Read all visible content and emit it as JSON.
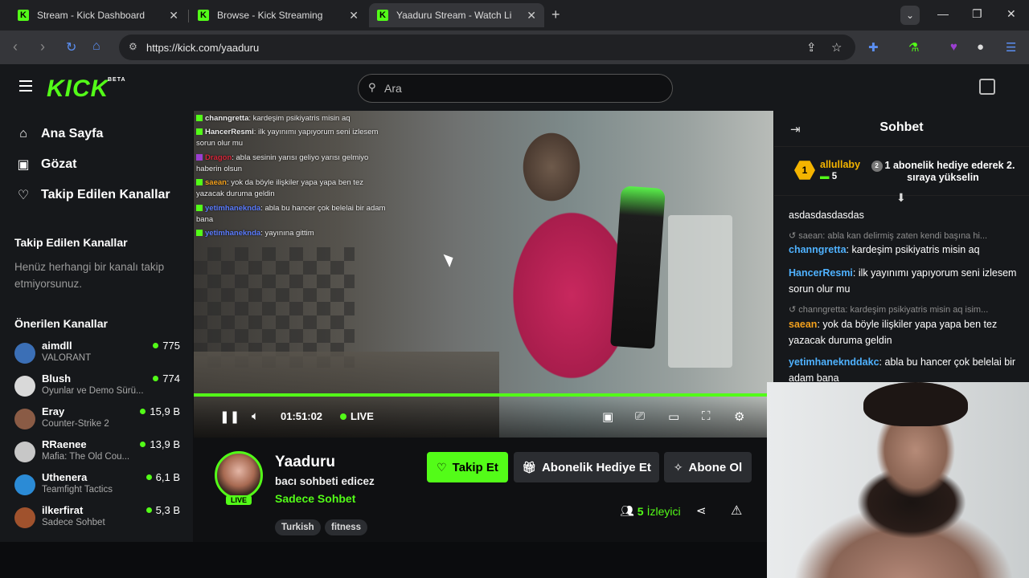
{
  "browser": {
    "tabs": [
      {
        "title": "Stream - Kick Dashboard",
        "active": false
      },
      {
        "title": "Browse - Kick Streaming",
        "active": false
      },
      {
        "title": "Yaaduru Stream - Watch Li",
        "active": true
      }
    ],
    "url": "https://kick.com/yaaduru"
  },
  "header": {
    "logo": "KICK",
    "logo_badge": "BETA",
    "search_placeholder": "Ara"
  },
  "sidebar": {
    "nav": [
      {
        "label": "Ana Sayfa",
        "icon": "home-icon"
      },
      {
        "label": "Gözat",
        "icon": "browse-icon"
      },
      {
        "label": "Takip Edilen Kanallar",
        "icon": "heart-icon"
      }
    ],
    "followed_title": "Takip Edilen Kanallar",
    "followed_empty": "Henüz herhangi bir kanalı takip etmiyorsunuz.",
    "recommended_title": "Önerilen Kanallar",
    "channels": [
      {
        "name": "aimdll",
        "category": "VALORANT",
        "viewers": "775",
        "color": "#3b6fb6"
      },
      {
        "name": "Blush",
        "category": "Oyunlar ve Demo Sürü...",
        "viewers": "774",
        "color": "#d9d9d9"
      },
      {
        "name": "Eray",
        "category": "Counter-Strike 2",
        "viewers": "15,9 B",
        "color": "#8a5b45"
      },
      {
        "name": "RRaenee",
        "category": "Mafia: The Old Cou...",
        "viewers": "13,9 B",
        "color": "#c7c7c7"
      },
      {
        "name": "Uthenera",
        "category": "Teamfight Tactics",
        "viewers": "6,1 B",
        "color": "#2b8bd6"
      },
      {
        "name": "ilkerfirat",
        "category": "Sadece Sohbet",
        "viewers": "5,3 B",
        "color": "#a0522d"
      }
    ]
  },
  "video": {
    "overlay_chat": [
      {
        "user": "channgretta",
        "color": "#ffffff",
        "text": ": kardeşim psikiyatris misin aq"
      },
      {
        "user": "HancerResmi",
        "color": "#ffffff",
        "text": ": ilk yayınımı yapıyorum seni izlesem sorun olur mu"
      },
      {
        "user": "Dragon",
        "color": "#d6263a",
        "text": ": abla sesinin yarısı geliyo yarısı gelmiyo haberin olsun"
      },
      {
        "user": "saean",
        "color": "#f2a01d",
        "text": ": yok da böyle ilişkiler yapa yapa ben tez yazacak duruma geldin"
      },
      {
        "user": "yetimhaneknda",
        "color": "#5b7cff",
        "text": ": abla bu hancer çok belelai bir adam bana"
      },
      {
        "user": "yetimhaneknda",
        "color": "#5b7cff",
        "text": ": yayınına gittim"
      }
    ],
    "timecode": "01:51:02",
    "live_label": "LIVE",
    "progress": 0.99
  },
  "channel": {
    "name": "Yaaduru",
    "title": "bacı sohbeti edicez",
    "category": "Sadece Sohbet",
    "live_badge": "LIVE",
    "tags": [
      "Turkish",
      "fitness"
    ],
    "follow_label": "Takip Et",
    "gift_label": "Abonelik Hediye Et",
    "subscribe_label": "Abone Ol",
    "viewer_count": "5",
    "viewer_label": "İzleyici"
  },
  "chat": {
    "title": "Sohbet",
    "pinned": {
      "rank": "1",
      "user": "allullaby",
      "count": "5",
      "rank2": "2",
      "message": "1 abonelik hediye ederek 2. sıraya yükselin"
    },
    "messages": [
      {
        "type": "text",
        "text": "asdasdasdasdas"
      },
      {
        "type": "reply",
        "text": "saean: abla kan delirmiş zaten kendi başına hi..."
      },
      {
        "type": "msg",
        "user": "channgretta",
        "color": "#4fb2ff",
        "text": ": kardeşim psikiyatris misin aq"
      },
      {
        "type": "msg",
        "user": "HancerResmi",
        "color": "#4fb2ff",
        "text": ": ilk yayınımı yapıyorum seni izlesem sorun olur mu"
      },
      {
        "type": "reply",
        "text": "channgretta: kardeşim psikiyatris misin aq isim..."
      },
      {
        "type": "msg",
        "user": "saean",
        "color": "#f2a01d",
        "text": ": yok da böyle ilişkiler yapa yapa ben tez yazacak duruma geldin"
      },
      {
        "type": "msg",
        "user": "yetimhaneknddakc",
        "color": "#4fb2ff",
        "text": ": abla bu hancer çok belelai bir adam bana"
      }
    ]
  }
}
